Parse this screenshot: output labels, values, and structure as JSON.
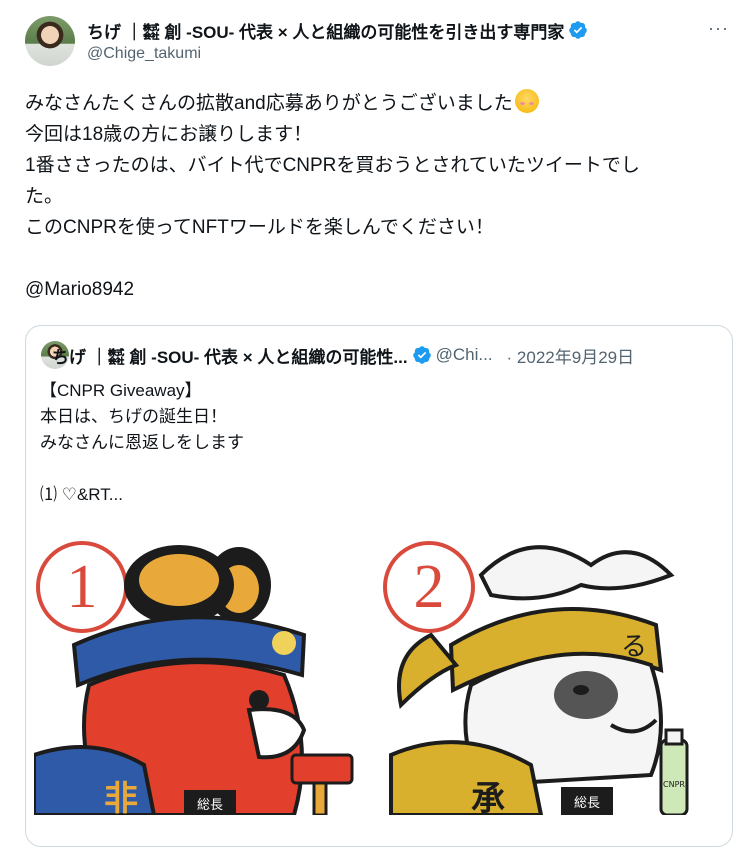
{
  "tweet": {
    "author_name": "ちげ ｜㍿ 創 -SOU- 代表 × 人と組織の可能性を引き出す専門家",
    "handle": "@Chige_takumi",
    "more": "···",
    "lines": [
      "みなさんたくさんの拡散and応募ありがとうございました",
      "今回は18歳の方にお譲りします！",
      "1番ささったのは、バイト代でCNPRを買おうとされていたツイートでし",
      "た。",
      "このCNPRを使ってNFTワールドを楽しんでください！",
      "",
      "@Mario8942"
    ],
    "emoji": "smiling-face-with-smiling-eyes"
  },
  "quote": {
    "author_name": "ちげ ｜㍿ 創 -SOU- 代表 × 人と組織の可能性...",
    "handle": "@Chi...",
    "date": "· 2022年9月29日",
    "lines": [
      "【CNPR Giveaway】",
      "本日は、ちげの誕生日！",
      "みなさんに恩返しをします",
      "",
      "⑴ ♡&RT..."
    ],
    "images": [
      {
        "number": "1",
        "sign": "総長",
        "kanji": "非"
      },
      {
        "number": "2",
        "sign": "総長",
        "kanji": "承",
        "bottle": "CNPR"
      }
    ]
  },
  "colors": {
    "verified": "#1d9bf0",
    "secondary_text": "#536471",
    "border": "#cfd9de"
  }
}
